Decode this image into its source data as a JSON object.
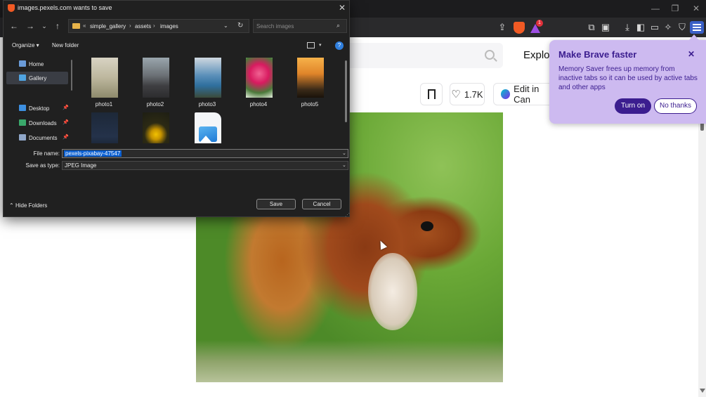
{
  "browser": {
    "window_controls": {
      "minimize": "—",
      "maximize": "❐",
      "close": "✕"
    },
    "toolbar_icons": [
      "share-icon",
      "brave-shields-icon",
      "brave-rewards-icon",
      "extensions-icon",
      "screenshot-icon",
      "downloads-icon",
      "sidebar-icon",
      "wallet-icon",
      "leo-ai-icon",
      "vpn-icon",
      "menu-icon"
    ],
    "rewards_badge": "1"
  },
  "webpage": {
    "explore_label": "Explore",
    "like_count": "1.7K",
    "edit_in_canva_label": "Edit in Can"
  },
  "brave_popup": {
    "title": "Make Brave faster",
    "body": "Memory Saver frees up memory from inactive tabs so it can be used by active tabs and other apps",
    "turn_on_label": "Turn on",
    "no_thanks_label": "No thanks",
    "close_glyph": "✕"
  },
  "dialog": {
    "title": "images.pexels.com wants to save",
    "close_glyph": "✕",
    "nav": {
      "back": "←",
      "forward": "→",
      "recent": "⌄",
      "up": "↑"
    },
    "breadcrumb": {
      "overflow": "«",
      "items": [
        "simple_gallery",
        "assets",
        "images"
      ],
      "separator": "›"
    },
    "search_placeholder": "Search images",
    "commands": {
      "organize": "Organize ▾",
      "new_folder": "New folder",
      "help": "?"
    },
    "nav_pane": [
      {
        "label": "Home",
        "color": "#6a9bd8",
        "pinned": false,
        "selected": false
      },
      {
        "label": "Gallery",
        "color": "#4fa3e0",
        "pinned": false,
        "selected": true
      },
      {
        "label": "Desktop",
        "color": "#3d8fe0",
        "pinned": true,
        "selected": false
      },
      {
        "label": "Downloads",
        "color": "#3aa86b",
        "pinned": true,
        "selected": false
      },
      {
        "label": "Documents",
        "color": "#8fa6c8",
        "pinned": true,
        "selected": false
      }
    ],
    "pin_glyph": "📌",
    "files": [
      {
        "name": "photo1",
        "thumb": "flowers"
      },
      {
        "name": "photo2",
        "thumb": "road"
      },
      {
        "name": "photo3",
        "thumb": "coast"
      },
      {
        "name": "photo4",
        "thumb": "rose"
      },
      {
        "name": "photo5",
        "thumb": "sunset"
      },
      {
        "name": "",
        "thumb": "dark"
      },
      {
        "name": "",
        "thumb": "yellow-flower"
      },
      {
        "name": "",
        "thumb": "image-file"
      }
    ],
    "file_name_label": "File name:",
    "file_name_value": "pexels-pixabay-47547",
    "save_as_type_label": "Save as type:",
    "save_as_type_value": "JPEG Image",
    "hide_folders_label": "Hide Folders",
    "save_label": "Save",
    "cancel_label": "Cancel"
  }
}
